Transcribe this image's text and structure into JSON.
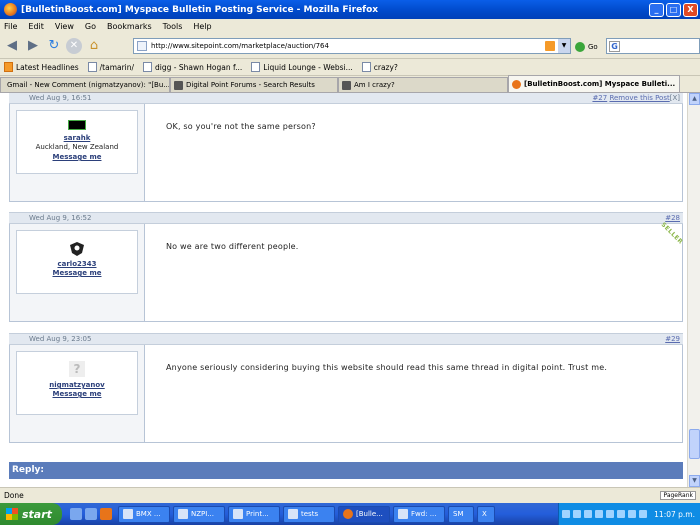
{
  "window": {
    "title": "[BulletinBoost.com] Myspace Bulletin Posting Service - Mozilla Firefox",
    "min": "_",
    "max": "□",
    "close": "X"
  },
  "menu": [
    "File",
    "Edit",
    "View",
    "Go",
    "Bookmarks",
    "Tools",
    "Help"
  ],
  "nav": {
    "url": "http://www.sitepoint.com/marketplace/auction/764",
    "go_label": "Go",
    "search_engine_icon": "G"
  },
  "bookmarks": [
    "Latest Headlines",
    "/tamarin/",
    "digg - Shawn Hogan f...",
    "Liquid Lounge - Websi...",
    "crazy?"
  ],
  "tabs": [
    {
      "label": "Gmail - New Comment (nigmatzyanov): \"[Bu..."
    },
    {
      "label": "Digital Point Forums - Search Results"
    },
    {
      "label": "Am I crazy?"
    },
    {
      "label": "[BulletinBoost.com] Myspace Bulleti..."
    }
  ],
  "posts": [
    {
      "date": "Wed Aug 9, 16:51",
      "num": "#27",
      "remove": "Remove this Post",
      "remove_x": "[X]",
      "user": "sarahk",
      "location": "Auckland, New Zealand",
      "message_me": "Message me",
      "text": "OK, so you're not the same person?"
    },
    {
      "date": "Wed Aug 9, 16:52",
      "num": "#28",
      "user": "carlo2343",
      "message_me": "Message me",
      "text": "No we are two different people.",
      "badge": "SELLER"
    },
    {
      "date": "Wed Aug 9, 23:05",
      "num": "#29",
      "user": "nigmatzyanov",
      "message_me": "Message me",
      "text": "Anyone seriously considering buying this website should read this same thread in digital point. Trust me.",
      "avatar_placeholder": "?"
    }
  ],
  "reply_label": "Reply:",
  "status": {
    "text": "Done",
    "pagerank": "PageRank"
  },
  "taskbar": {
    "start": "start",
    "items": [
      "BMX ...",
      "NZPI...",
      "Print...",
      "tests",
      "[Bulle...",
      "Fwd: ...",
      "SM",
      "X"
    ],
    "clock": "11:07 p.m."
  }
}
